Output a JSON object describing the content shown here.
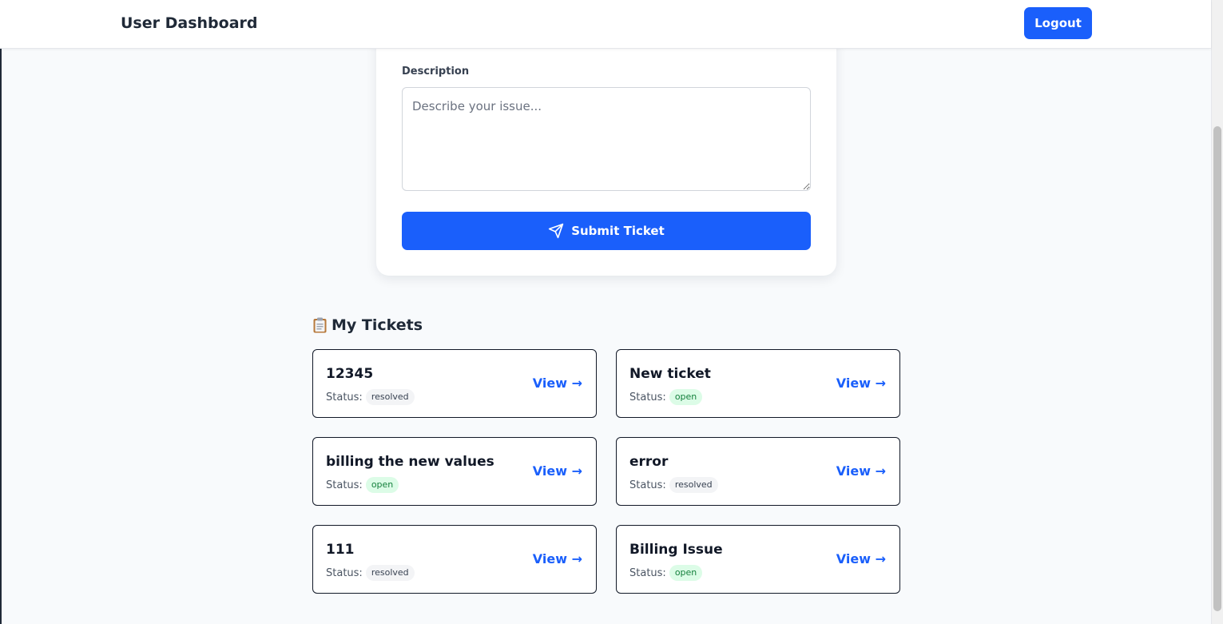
{
  "header": {
    "title": "User Dashboard",
    "logout_label": "Logout"
  },
  "form": {
    "description_label": "Description",
    "description_placeholder": "Describe your issue...",
    "description_value": "",
    "submit_label": "Submit Ticket"
  },
  "tickets_section": {
    "icon": "clipboard-icon",
    "title": "My Tickets",
    "status_prefix": "Status:",
    "view_label": "View →",
    "items": [
      {
        "title": "12345",
        "status": "resolved"
      },
      {
        "title": "New ticket",
        "status": "open"
      },
      {
        "title": "billing the new values",
        "status": "open"
      },
      {
        "title": "error",
        "status": "resolved"
      },
      {
        "title": "111",
        "status": "resolved"
      },
      {
        "title": "Billing Issue",
        "status": "open"
      }
    ]
  },
  "colors": {
    "primary": "#1a5ffb",
    "background": "#f8fafc",
    "open_badge_bg": "#dcfce7",
    "open_badge_text": "#15803d",
    "resolved_badge_bg": "#f3f4f6"
  }
}
